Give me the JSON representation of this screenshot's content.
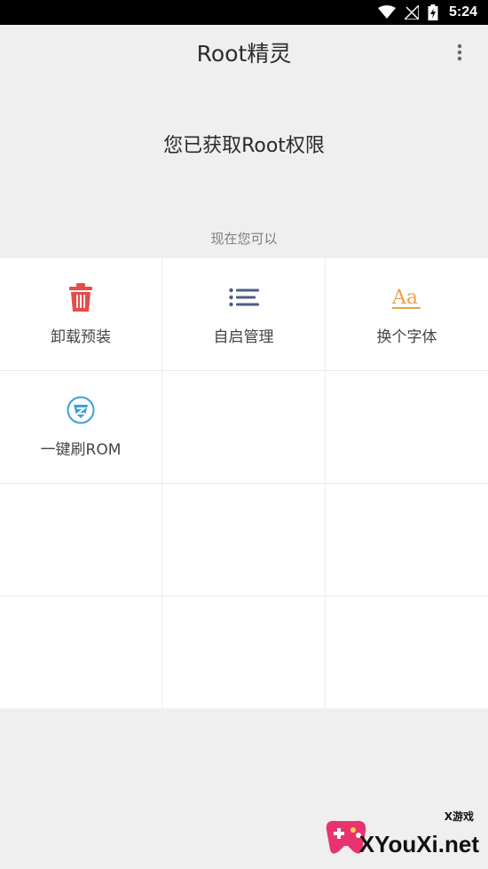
{
  "status_bar": {
    "time": "5:24"
  },
  "app_bar": {
    "title": "Root精灵"
  },
  "root_status": "您已获取Root权限",
  "section_label": "现在您可以",
  "tools": [
    {
      "label": "卸载预装",
      "icon": "trash-icon",
      "color": "#e84a4a"
    },
    {
      "label": "自启管理",
      "icon": "list-icon",
      "color": "#4a5f86"
    },
    {
      "label": "换个字体",
      "icon": "font-icon",
      "color": "#e8a44a"
    },
    {
      "label": "一键刷ROM",
      "icon": "shield-icon",
      "color": "#3b9ee0"
    }
  ],
  "watermark": {
    "small": "X游戏",
    "text": "XYouXi.net"
  }
}
